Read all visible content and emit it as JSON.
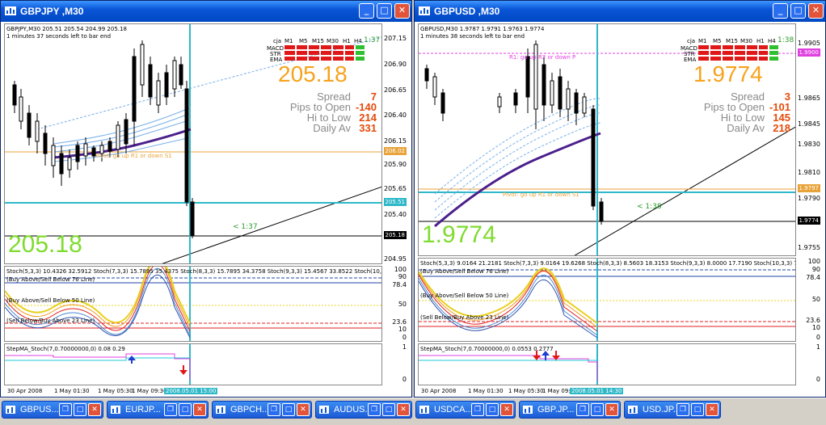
{
  "windows": [
    {
      "title": "GBPJPY ,M30",
      "symbol_line": "GBPJPY,M30  205.51 205.54 204.99 205.18",
      "timer_line": "1 minutes 37 seconds left to bar end",
      "price_big": "205.18",
      "price_big_bottom": "205.18",
      "stats": {
        "spread_label": "Spread",
        "spread": "7",
        "pto_label": "Pips to Open",
        "pto": "-140",
        "hl_label": "Hi to Low",
        "hl": "214",
        "da_label": "Daily Av",
        "da": "331"
      },
      "tf_header": [
        "cja",
        "M1",
        "M5",
        "M15",
        "M30",
        "H1",
        "H4",
        "D1"
      ],
      "tf_rows": [
        "MACD",
        "STR",
        "EMA"
      ],
      "tf_extra": "1:37",
      "countdown": "< 1:37",
      "pivot_text": "Pivot: go up R1 or down S1",
      "price_axis": [
        "207.15",
        "206.90",
        "206.65",
        "206.40",
        "206.15",
        "205.90",
        "205.65",
        "205.40",
        "204.95"
      ],
      "price_tags": [
        {
          "v": "206.02",
          "c": "#e8a33a"
        },
        {
          "v": "205.51",
          "c": "#2fb8c8"
        },
        {
          "v": "205.18",
          "c": "#000000"
        }
      ],
      "stoch_header": "Stoch(5,3,3) 10.4326 32.5912  Stoch(7,3,3) 15.7895 35.4375  Stoch(8,3,3) 15.7895 34.3758  Stoch(9,3,3) 15.4567 33.8522  Stoch(10,3,3) 14",
      "stoch_labels": [
        "(Buy Above/Sell Below 76 Line)",
        "(Buy Above/Sell Below 50 Line)",
        "(Sell Below/Buy Above 23 Line)"
      ],
      "stoch_axis": [
        "100",
        "90",
        "78.4",
        "50",
        "23.6",
        "10",
        "0"
      ],
      "stepma_header": "StepMA_Stoch(7,0.70000000,0) 0.08 0.29",
      "stepma_axis": [
        "1",
        "0"
      ],
      "x_labels": [
        "30 Apr 2008",
        "1 May 01:30",
        "1 May 05:30",
        "1 May 09:30"
      ],
      "x_cursor": "2008.05.01 15:00"
    },
    {
      "title": "GBPUSD ,M30",
      "symbol_line": "GBPUSD,M30  1.9787 1.9791 1.9763 1.9774",
      "timer_line": "1 minutes 38 seconds left to bar end",
      "price_big": "1.9774",
      "price_big_bottom": "1.9774",
      "stats": {
        "spread_label": "Spread",
        "spread": "3",
        "pto_label": "Pips to Open",
        "pto": "-101",
        "hl_label": "Hi to Low",
        "hl": "145",
        "da_label": "Daily Av",
        "da": "218"
      },
      "tf_header": [
        "cja",
        "M1",
        "M5",
        "M15",
        "M30",
        "H1",
        "H4",
        "D1"
      ],
      "tf_rows": [
        "MACD",
        "STR",
        "EMA"
      ],
      "tf_extra": "1:38",
      "countdown": "< 1:38",
      "pivot_text": "Pivot: go up R1 or down S1",
      "r1_text": "R1: go up R2 or down P",
      "price_axis": [
        "1.9905",
        "1.9865",
        "1.9845",
        "1.9830",
        "1.9810",
        "1.9790",
        "1.9755"
      ],
      "price_tags": [
        {
          "v": "1.9900",
          "c": "#e040e0"
        },
        {
          "v": "1.9797",
          "c": "#e8a33a"
        },
        {
          "v": "1.9774",
          "c": "#000000"
        }
      ],
      "stoch_header": "Stoch(5,3,3) 9.0164 21.2181  Stoch(7,3,3) 9.0164 19.6268  Stoch(8,3,3) 8.5603 18.3153  Stoch(9,3,3) 8.0000 17.7190  Stoch(10,3,3) 7.8231",
      "stoch_labels": [
        "(Buy Above/Sell Below 76 Line)",
        "(Buy Above/Sell Below 50 Line)",
        "(Sell Below/Buy Above 23 Line)"
      ],
      "stoch_axis": [
        "100",
        "90",
        "78.4",
        "50",
        "23.6",
        "10",
        "0"
      ],
      "stepma_header": "StepMA_Stoch(7,0.70000000,0) 0.0553 0.2777",
      "stepma_axis": [
        "1",
        "0"
      ],
      "x_labels": [
        "30 Apr 2008",
        "1 May 01:30",
        "1 May 05:30",
        "1 May 09:30"
      ],
      "x_cursor": "2008.05.01 14:30"
    }
  ],
  "taskbar": [
    {
      "label": "GBPUS..."
    },
    {
      "label": "EURJP..."
    },
    {
      "label": "GBPCH..."
    },
    {
      "label": "AUDUS..."
    },
    {
      "label": "USDCA..."
    },
    {
      "label": "GBP.JP..."
    },
    {
      "label": "USD.JP..."
    }
  ],
  "colors": {
    "accent_price": "#f7a21c",
    "accent_green": "#7fdb2f",
    "stat_value": "#e64a0a",
    "cursor_line": "#2fb8c8",
    "titlebar": "#0a56d8"
  }
}
